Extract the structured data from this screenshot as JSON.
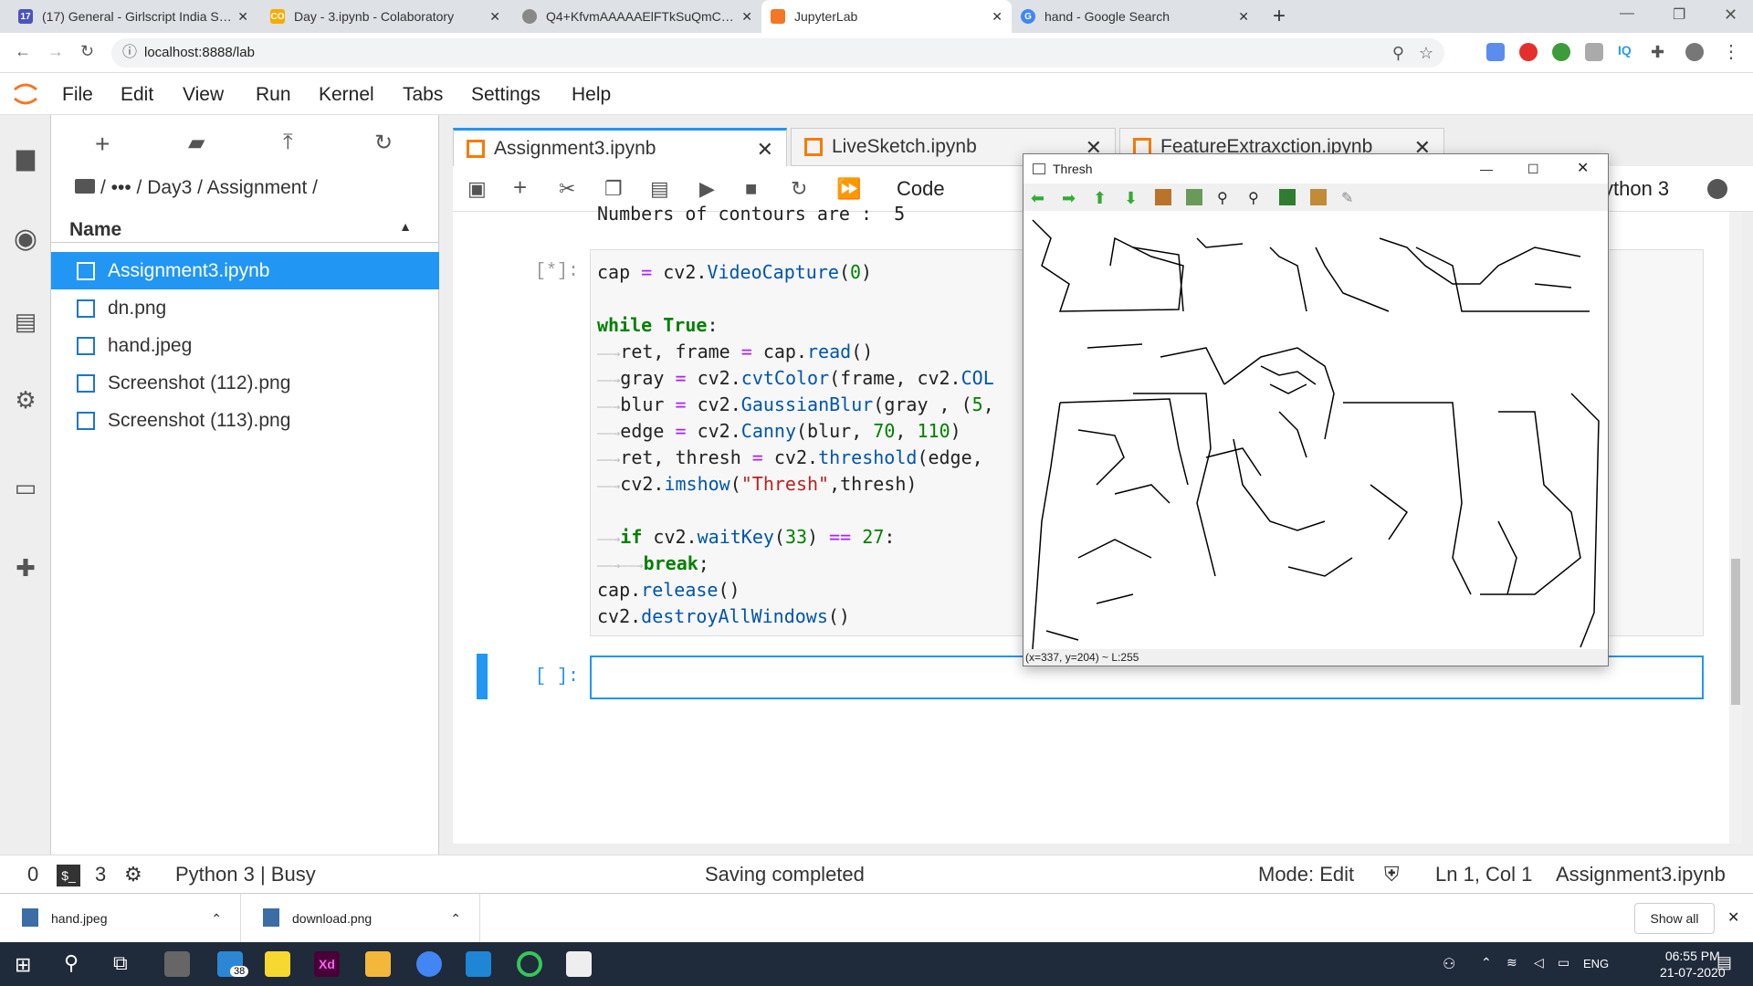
{
  "browser": {
    "tabs": [
      {
        "title": "(17) General - Girlscript India Sun",
        "fav": "#4b53bc",
        "favtext": "17"
      },
      {
        "title": "Day - 3.ipynb - Colaboratory",
        "fav": "#f9ab00",
        "favtext": "CO"
      },
      {
        "title": "Q4+KfvmAAAAAElFTkSuQmCC (3",
        "fav": "#888",
        "favtext": ""
      },
      {
        "title": "JupyterLab",
        "fav": "#f37726",
        "favtext": ""
      },
      {
        "title": "hand - Google Search",
        "fav": "#4285f4",
        "favtext": "G"
      }
    ],
    "url": "localhost:8888/lab"
  },
  "jupyter": {
    "menus": [
      "File",
      "Edit",
      "View",
      "Run",
      "Kernel",
      "Tabs",
      "Settings",
      "Help"
    ],
    "breadcrumb": "/   •••  / Day3 / Assignment /",
    "file_header": "Name",
    "files": [
      "Assignment3.ipynb",
      "dn.png",
      "hand.jpeg",
      "Screenshot (112).png",
      "Screenshot (113).png"
    ],
    "notebook_tabs": [
      "Assignment3.ipynb",
      "LiveSketch.ipynb",
      "FeatureExtraxction.ipynb"
    ],
    "cell_type": "Code",
    "kernel_name": "ython 3",
    "output_text": "Numbers of contours are :  5",
    "running_prompt": "[*]:",
    "empty_prompt": "[ ]:"
  },
  "cv_window": {
    "title": "Thresh",
    "status": "(x=337, y=204) ~ L:255"
  },
  "statusbar": {
    "left_count": "0",
    "terminals": "3",
    "kernel": "Python 3 | Busy",
    "message": "Saving completed",
    "mode": "Mode: Edit",
    "position": "Ln 1, Col 1",
    "file": "Assignment3.ipynb"
  },
  "downloads": {
    "items": [
      "hand.jpeg",
      "download.png"
    ],
    "show_all": "Show all"
  },
  "taskbar": {
    "badge": "38",
    "lang": "ENG",
    "time": "06:55 PM",
    "date": "21-07-2020"
  },
  "colors": {
    "accent": "#2196f3",
    "notebook_orange": "#f57c00"
  }
}
